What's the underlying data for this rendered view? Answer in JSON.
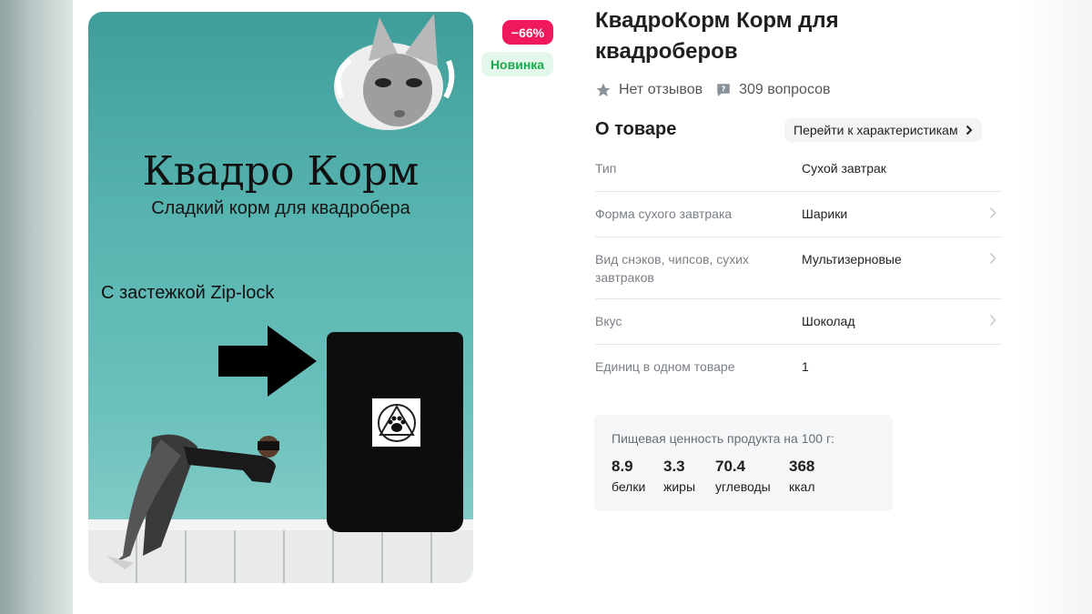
{
  "image": {
    "title": "Квадро Корм",
    "subtitle": "Сладкий корм для квадробера",
    "ziplock": "С застежкой Zip-lock"
  },
  "badges": {
    "discount": "−66%",
    "new": "Новинка"
  },
  "product": {
    "title": "КвадроКорм Корм для квадроберов"
  },
  "meta": {
    "reviews": "Нет отзывов",
    "questions": "309 вопросов"
  },
  "about": {
    "title": "О товаре",
    "specs_link": "Перейти к характеристикам",
    "specs": [
      {
        "key": "Тип",
        "value": "Сухой завтрак"
      },
      {
        "key": "Форма сухого завтрака",
        "value": "Шарики"
      },
      {
        "key": "Вид снэков, чипсов, сухих завтраков",
        "value": "Мультизерновые"
      },
      {
        "key": "Вкус",
        "value": "Шоколад"
      },
      {
        "key": "Единиц в одном товаре",
        "value": "1"
      }
    ]
  },
  "nutrition": {
    "title": "Пищевая ценность продукта на 100 г:",
    "items": [
      {
        "value": "8.9",
        "label": "белки"
      },
      {
        "value": "3.3",
        "label": "жиры"
      },
      {
        "value": "70.4",
        "label": "углеводы"
      },
      {
        "value": "368",
        "label": "ккал"
      }
    ]
  },
  "colors": {
    "discount_badge": "#f0195b",
    "new_badge_bg": "#e3f7ea",
    "new_badge_text": "#1ba94f",
    "image_background": "#56b3af"
  }
}
